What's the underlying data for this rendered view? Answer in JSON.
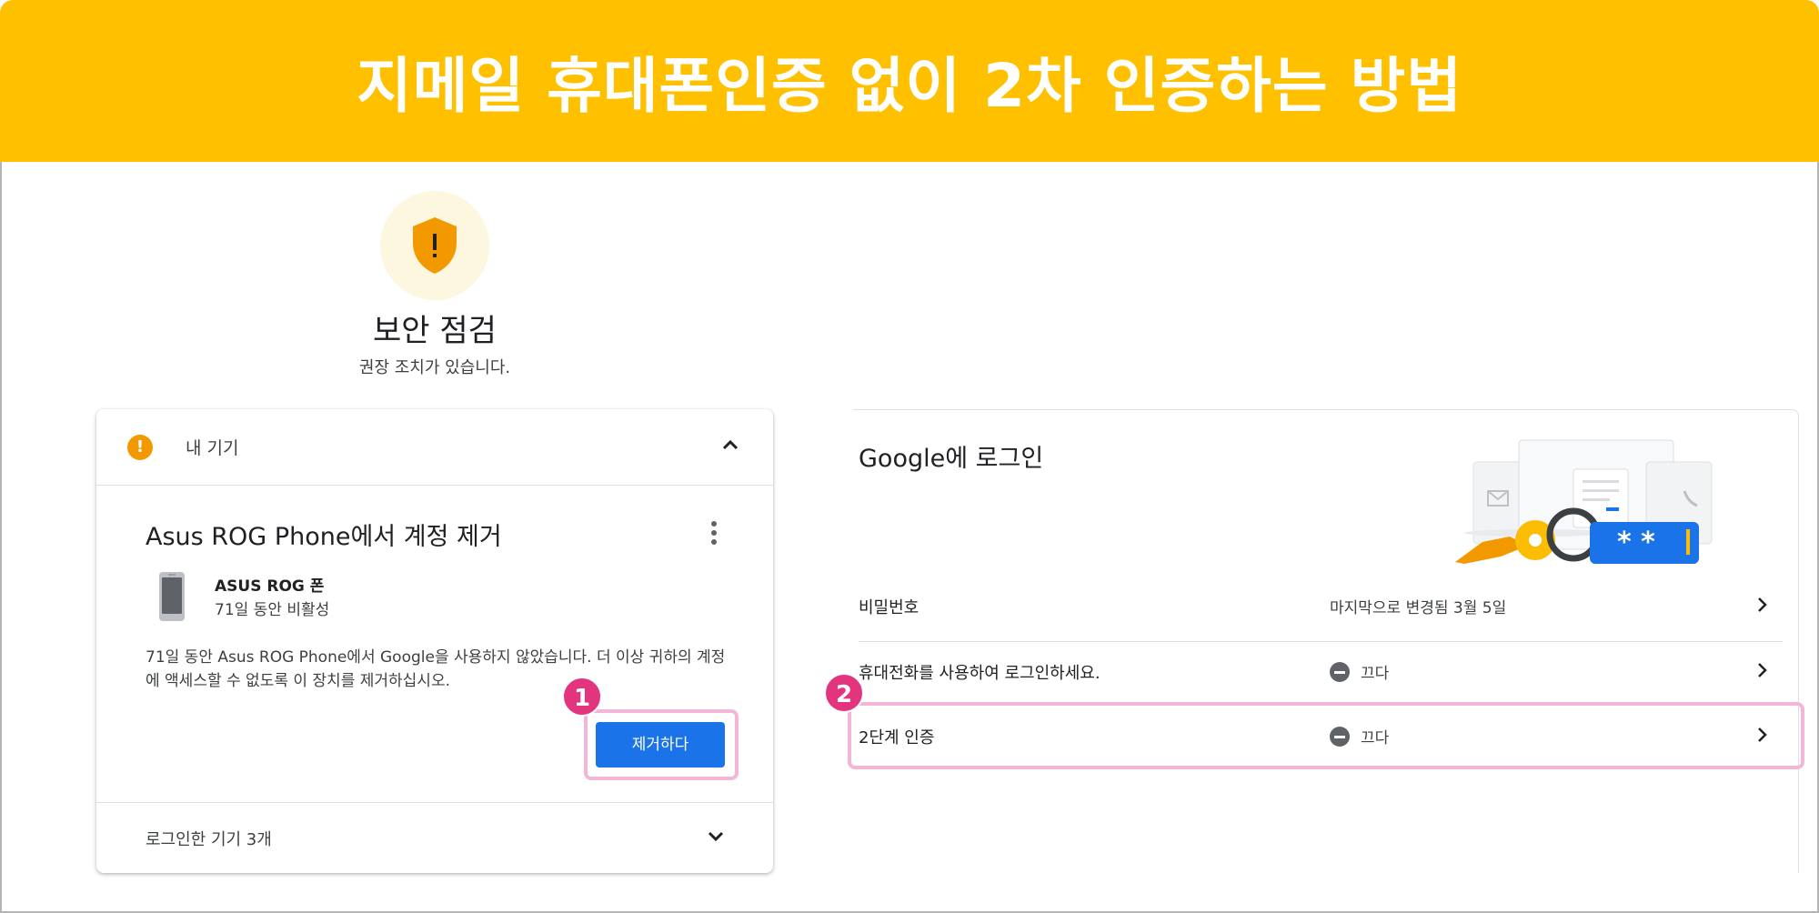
{
  "banner": {
    "title": "지메일 휴대폰인증 없이 2차 인증하는 방법"
  },
  "security_check": {
    "title": "보안 점검",
    "subtitle": "권장 조치가 있습니다.",
    "icon": "shield-warning-icon",
    "accent": "#F29900"
  },
  "my_devices": {
    "header_label": "내 기기",
    "warning_symbol": "!",
    "card_title": "Asus ROG Phone에서 계정 제거",
    "device_name": "ASUS ROG 폰",
    "device_status": "71일 동안 비활성",
    "description": "71일 동안 Asus ROG Phone에서 Google을 사용하지 않았습니다. 더 이상 귀하의 계정에 액세스할 수 없도록 이 장치를 제거하십시오.",
    "remove_button": "제거하다",
    "footer_label": "로그인한 기기 3개"
  },
  "google_signin": {
    "title": "Google에 로그인",
    "rows": [
      {
        "label": "비밀번호",
        "value": "마지막으로 변경됨 3월 5일"
      },
      {
        "label": "휴대전화를 사용하여 로그인하세요.",
        "value": "끄다"
      },
      {
        "label": "2단계 인증",
        "value": "끄다"
      }
    ]
  },
  "annotations": {
    "badge1": "1",
    "badge2": "2"
  },
  "colors": {
    "banner": "#FFC000",
    "button": "#1a73e8",
    "highlight": "#F4B6D6",
    "badge": "#E2357E"
  }
}
